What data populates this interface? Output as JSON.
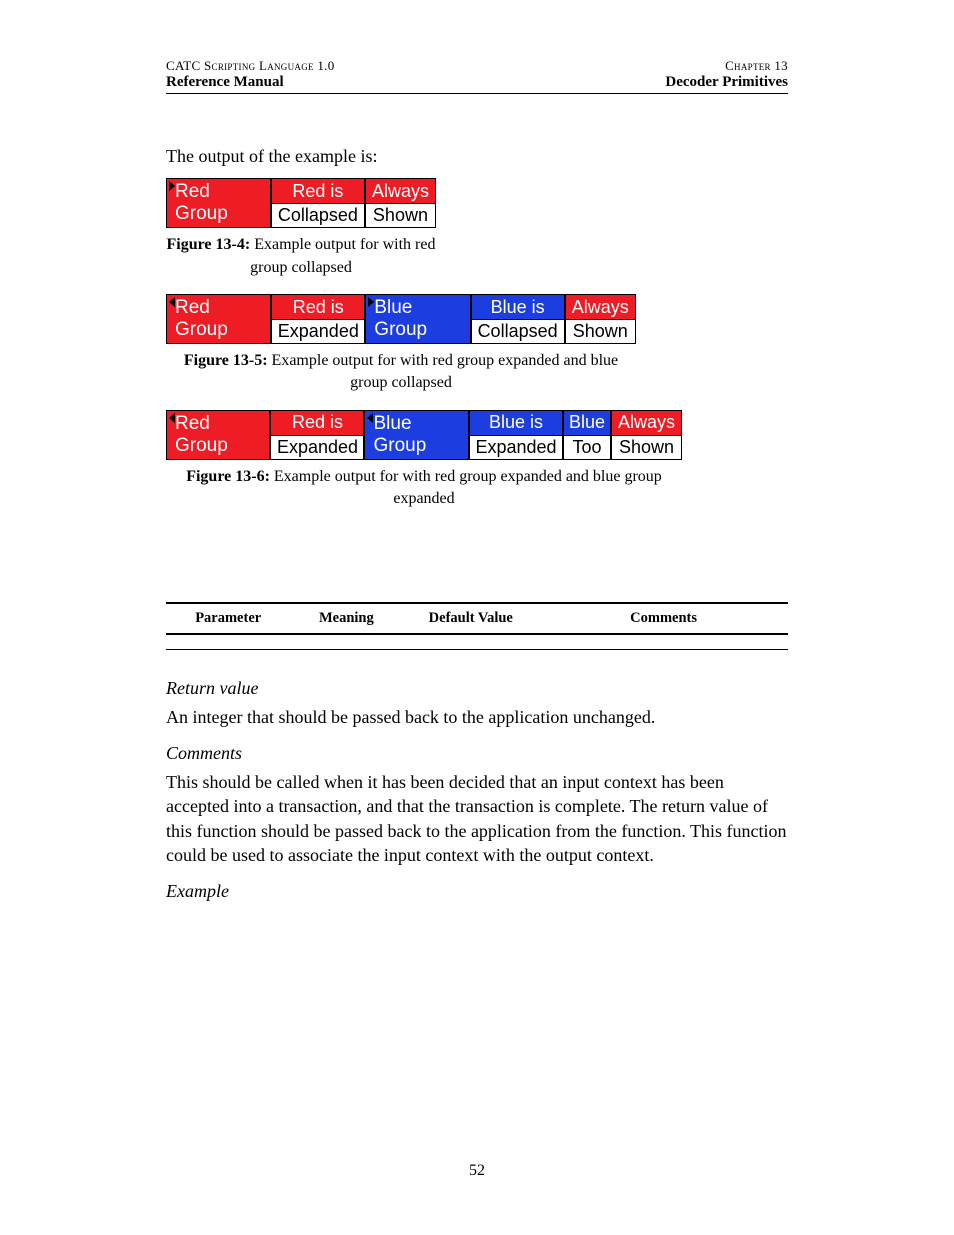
{
  "header": {
    "left_top": "CATC Scripting Language 1.0",
    "right_top": "Chapter 13",
    "left_bottom": "Reference Manual",
    "right_bottom": "Decoder Primitives"
  },
  "intro": "The output of the example is:",
  "figures": {
    "f4": {
      "red_label": "Red Group",
      "red_top": "Red is",
      "red_bottom": "Collapsed",
      "always_top": "Always",
      "always_bottom": "Shown",
      "caption_label": "Figure 13-4:",
      "caption_text_a": "Example output for ",
      "caption_text_b": " with red group collapsed"
    },
    "f5": {
      "red_label": "Red Group",
      "red_top": "Red is",
      "red_bottom": "Expanded",
      "blue_label": "Blue Group",
      "blue_top": "Blue is",
      "blue_bottom": "Collapsed",
      "always_top": "Always",
      "always_bottom": "Shown",
      "caption_label": "Figure 13-5:",
      "caption_text_a": "Example output for ",
      "caption_text_b": " with red group expanded and blue group collapsed"
    },
    "f6": {
      "red_label": "Red Group",
      "red_top": "Red is",
      "red_bottom": "Expanded",
      "blue_label": "Blue Group",
      "blue_top": "Blue is",
      "blue_bottom": "Expanded",
      "bluetoo_top": "Blue",
      "bluetoo_bottom": "Too",
      "always_top": "Always",
      "always_bottom": "Shown",
      "caption_label": "Figure 13-6:",
      "caption_text_a": "Example output for ",
      "caption_text_b": " with red group expanded and blue group expanded"
    }
  },
  "table": {
    "headers": [
      "Parameter",
      "Meaning",
      "Default Value",
      "Comments"
    ]
  },
  "sections": {
    "return_head": "Return value",
    "return_body": "An integer that should be passed back to the application unchanged.",
    "comments_head": "Comments",
    "comments_body": "This should be called when it has been decided that an input context has been accepted into a transaction, and that the transaction is complete.  The return value of this function should be passed back to the application from the function.  This function could be used to associate the input context with the output context.",
    "example_head": "Example"
  },
  "page_number": "52"
}
